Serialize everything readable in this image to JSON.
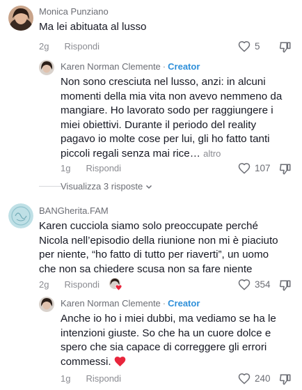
{
  "comments": [
    {
      "username": "Monica Punziano",
      "text": "Ma lei abituata al lusso",
      "time": "2g",
      "reply_label": "Rispondi",
      "likes": "5",
      "replies": [
        {
          "username": "Karen Norman Clemente",
          "separator": "·",
          "badge": "Creator",
          "text": "Non sono cresciuta nel lusso, anzi: in alcuni momenti della mia vita non avevo nemmeno da mangiare. Ho lavorato sodo per raggiungere i miei obiettivi. Durante il periodo del reality pagavo io molte cose per lui, gli ho fatto tanti piccoli regali senza mai rice…",
          "more_label": "altro",
          "time": "1g",
          "reply_label": "Rispondi",
          "likes": "107"
        }
      ],
      "view_replies_label": "Visualizza 3 risposte"
    },
    {
      "username": "BANGherita.FAM",
      "text": "Karen cucciola siamo solo preoccupate perché Nicola nell’episodio della riunione non mi è piaciuto per niente, “ho fatto di tutto per riaverti”, un uomo che non sa chiedere scusa non sa fare niente",
      "time": "2g",
      "reply_label": "Rispondi",
      "likes": "354",
      "replies": [
        {
          "username": "Karen Norman Clemente",
          "separator": "·",
          "badge": "Creator",
          "text": "Anche io ho i miei dubbi, ma vediamo se ha le intenzioni giuste. So che ha un cuore dolce e spero che sia capace di correggere gli errori commessi.",
          "emoji": "❤️",
          "time": "1g",
          "reply_label": "Rispondi",
          "likes": "240"
        }
      ]
    }
  ],
  "colors": {
    "creator_badge": "#2e8fd9",
    "secondary_text": "#8a8b91",
    "heart_red": "#e8253c"
  }
}
